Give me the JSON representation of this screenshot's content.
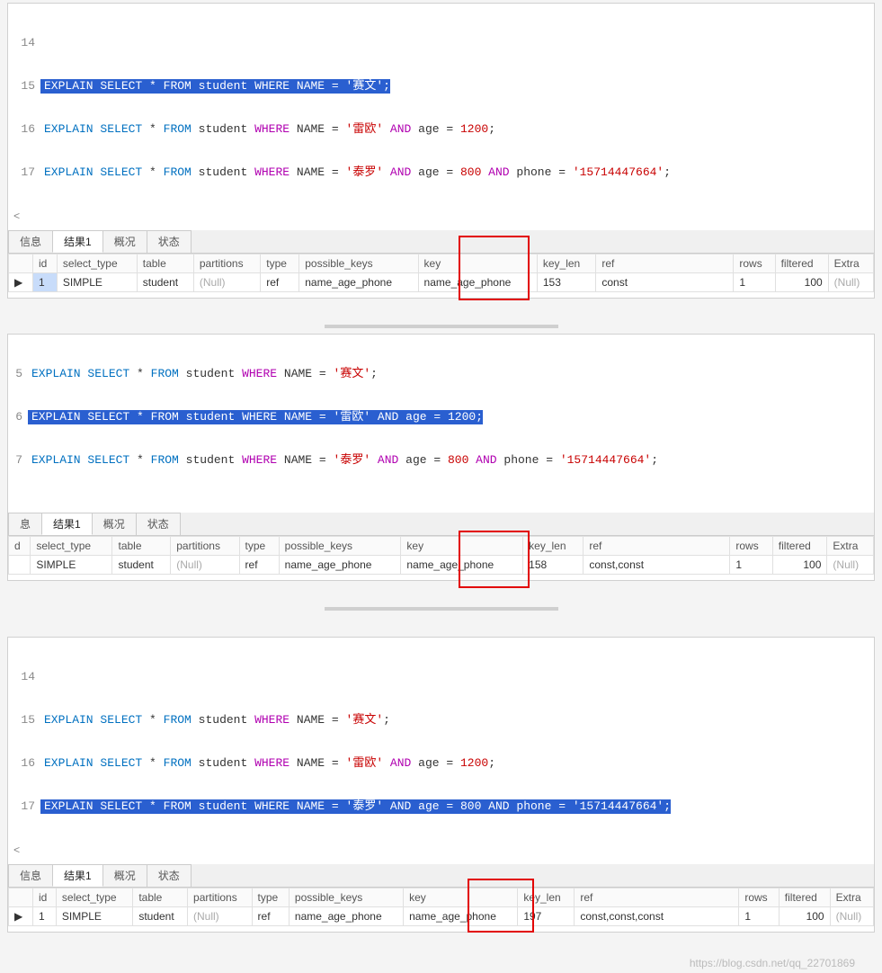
{
  "watermark": "https://blog.csdn.net/qq_22701869",
  "tabs": {
    "info": "信息",
    "result": "结果1",
    "summary": "概况",
    "status": "状态"
  },
  "columns": {
    "marker": "",
    "id": "id",
    "select_type": "select_type",
    "table": "table",
    "partitions": "partitions",
    "type": "type",
    "possible_keys": "possible_keys",
    "key": "key",
    "key_len": "key_len",
    "ref": "ref",
    "rows": "rows",
    "filtered": "filtered",
    "extra": "Extra"
  },
  "null_text": "(Null)",
  "row_marker": "▶",
  "panel1": {
    "scroll_hint": "<",
    "lines": {
      "l14": "14",
      "l15": "15",
      "l16": "16",
      "l17": "17"
    },
    "sql15": {
      "explain": "EXPLAIN",
      "select": "SELECT",
      "star": " * ",
      "from": "FROM",
      "tbl": " student ",
      "where": "WHERE",
      "name": " NAME ",
      "eq": "= ",
      "str": "'赛文'",
      "semi": ";"
    },
    "sql16": {
      "explain": "EXPLAIN",
      "select": "SELECT",
      "star": " * ",
      "from": "FROM",
      "tbl": " student ",
      "where": "WHERE",
      "name": " NAME ",
      "eq": "= ",
      "str": "'雷欧'",
      "and1": " AND",
      "age": " age ",
      "eq2": "= ",
      "num": "1200",
      "semi": ";"
    },
    "sql17": {
      "explain": "EXPLAIN",
      "select": "SELECT",
      "star": " * ",
      "from": "FROM",
      "tbl": " student ",
      "where": "WHERE",
      "name": " NAME ",
      "eq": "= ",
      "str": "'泰罗'",
      "and1": " AND",
      "age": " age ",
      "eq2": "= ",
      "num": "800",
      "and2": " AND",
      "phone": " phone ",
      "eq3": "= ",
      "str2": "'15714447664'",
      "semi": ";"
    },
    "row": {
      "id": "1",
      "select_type": "SIMPLE",
      "table": "student",
      "type": "ref",
      "possible_keys": "name_age_phone",
      "key": "name_age_phone",
      "key_len": "153",
      "ref": "const",
      "rows": "1",
      "filtered": "100"
    }
  },
  "panel2": {
    "lines": {
      "l5": "5",
      "l6": "6",
      "l7": "7"
    },
    "sql5": {
      "explain": "EXPLAIN",
      "select": "SELECT",
      "star": " * ",
      "from": "FROM",
      "tbl": " student ",
      "where": "WHERE",
      "name": " NAME ",
      "eq": "= ",
      "str": "'赛文'",
      "semi": ";"
    },
    "sql6": {
      "explain": "EXPLAIN",
      "select": "SELECT",
      "star": " * ",
      "from": "FROM",
      "tbl": " student ",
      "where": "WHERE",
      "name": " NAME ",
      "eq": "= ",
      "str": "'雷欧'",
      "and1": " AND",
      "age": " age ",
      "eq2": "= ",
      "num": "1200",
      "semi": ";"
    },
    "sql7": {
      "explain": "EXPLAIN",
      "select": "SELECT",
      "star": " * ",
      "from": "FROM",
      "tbl": " student ",
      "where": "WHERE",
      "name": " NAME ",
      "eq": "= ",
      "str": "'泰罗'",
      "and1": " AND",
      "age": " age ",
      "eq2": "= ",
      "num": "800",
      "and2": " AND",
      "phone": " phone ",
      "eq3": "= ",
      "str2": "'15714447664'",
      "semi": ";"
    },
    "tabs_alt_first": "息",
    "row": {
      "id": "",
      "select_type": "SIMPLE",
      "table": "student",
      "type": "ref",
      "possible_keys": "name_age_phone",
      "key": "name_age_phone",
      "key_len": "158",
      "ref": "const,const",
      "rows": "1",
      "filtered": "100"
    },
    "id_header_short": "d"
  },
  "panel3": {
    "scroll_hint": "<",
    "lines": {
      "l14": "14",
      "l15": "15",
      "l16": "16",
      "l17": "17"
    },
    "sql15": {
      "explain": "EXPLAIN",
      "select": "SELECT",
      "star": " * ",
      "from": "FROM",
      "tbl": " student ",
      "where": "WHERE",
      "name": " NAME ",
      "eq": "= ",
      "str": "'赛文'",
      "semi": ";"
    },
    "sql16": {
      "explain": "EXPLAIN",
      "select": "SELECT",
      "star": " * ",
      "from": "FROM",
      "tbl": " student ",
      "where": "WHERE",
      "name": " NAME ",
      "eq": "= ",
      "str": "'雷欧'",
      "and1": " AND",
      "age": " age ",
      "eq2": "= ",
      "num": "1200",
      "semi": ";"
    },
    "sql17": {
      "explain": "EXPLAIN",
      "select": "SELECT",
      "star": " * ",
      "from": "FROM",
      "tbl": " student ",
      "where": "WHERE",
      "name": " NAME ",
      "eq": "= ",
      "str": "'泰罗'",
      "and1": " AND",
      "age": " age ",
      "eq2": "= ",
      "num": "800",
      "and2": " AND",
      "phone": " phone ",
      "eq3": "= ",
      "str2": "'15714447664'",
      "semi": ";"
    },
    "row": {
      "id": "1",
      "select_type": "SIMPLE",
      "table": "student",
      "type": "ref",
      "possible_keys": "name_age_phone",
      "key": "name_age_phone",
      "key_len": "197",
      "ref": "const,const,const",
      "rows": "1",
      "filtered": "100"
    }
  }
}
